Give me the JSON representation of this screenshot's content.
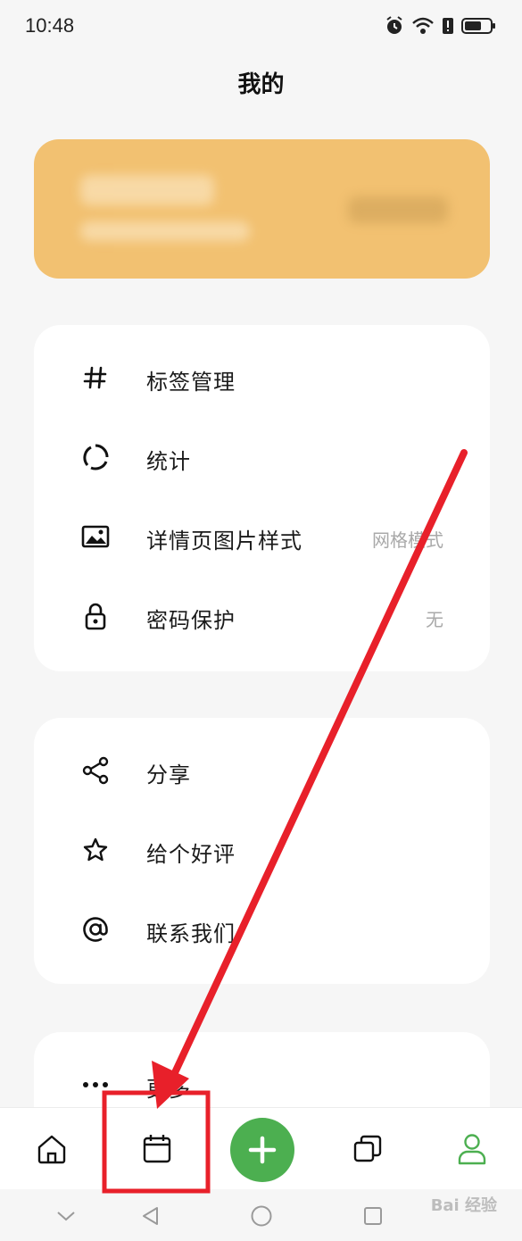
{
  "status": {
    "time": "10:48",
    "icons": [
      "alarm-icon",
      "wifi-icon",
      "alert-icon",
      "battery-icon"
    ]
  },
  "header": {
    "title": "我的"
  },
  "banner": {
    "title": "",
    "subtitle": "",
    "action": "",
    "colors": {
      "background": "#f2c171"
    }
  },
  "settings_group_1": {
    "items": [
      {
        "icon": "hash-icon",
        "label": "标签管理",
        "value": ""
      },
      {
        "icon": "stats-ring-icon",
        "label": "统计",
        "value": ""
      },
      {
        "icon": "image-icon",
        "label": "详情页图片样式",
        "value": "网格模式"
      },
      {
        "icon": "lock-icon",
        "label": "密码保护",
        "value": "无"
      }
    ]
  },
  "settings_group_2": {
    "items": [
      {
        "icon": "share-icon",
        "label": "分享"
      },
      {
        "icon": "star-icon",
        "label": "给个好评"
      },
      {
        "icon": "at-icon",
        "label": "联系我们"
      }
    ]
  },
  "settings_group_3": {
    "items": [
      {
        "icon": "more-icon",
        "label": "更多"
      }
    ]
  },
  "bottom_nav": {
    "items": [
      "home-icon",
      "calendar-icon",
      "add-icon",
      "copy-icon",
      "profile-icon"
    ],
    "active": "profile-icon",
    "colors": {
      "accent": "#4caf50"
    }
  },
  "system_nav": [
    "back-chevron-icon",
    "triangle-back-icon",
    "home-circle-icon",
    "recent-square-icon"
  ],
  "annotation": {
    "colors": {
      "arrow": "#e8202a",
      "box": "#e8202a"
    }
  },
  "watermark": {
    "text": "Bai 经验"
  }
}
